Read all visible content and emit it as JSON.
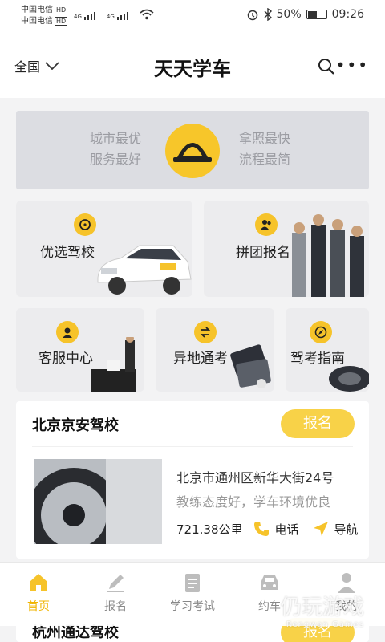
{
  "status_bar": {
    "carrier1": "中国电信",
    "carrier2": "中国电信",
    "hd": "HD",
    "net": "4G",
    "battery": "50%",
    "time": "09:26"
  },
  "header": {
    "city": "全国",
    "title": "天天学车"
  },
  "banner": {
    "left_line1": "城市最优",
    "left_line2": "服务最好",
    "right_line1": "拿照最快",
    "right_line2": "流程最简"
  },
  "tiles": {
    "t1": "优选驾校",
    "t2": "拼团报名",
    "t3": "客服中心",
    "t4": "异地通考",
    "t5": "驾考指南"
  },
  "school1": {
    "name": "北京京安驾校",
    "signup": "报名",
    "address": "北京市通州区新华大街24号",
    "desc": "教练态度好，学车环境优良",
    "distance": "721.38公里",
    "phone": "电话",
    "nav": "导航"
  },
  "school2": {
    "name": "杭州通达驾校",
    "signup": "报名"
  },
  "bottom_nav": {
    "home": "首页",
    "signup": "报名",
    "study": "学习考试",
    "practice": "约车",
    "mine": "我的"
  },
  "watermark": {
    "text": "仍玩游戏",
    "sub": "Rengwan Games"
  },
  "colors": {
    "accent": "#f6c32a",
    "button": "#f8d248",
    "active_nav": "#f0b400"
  }
}
